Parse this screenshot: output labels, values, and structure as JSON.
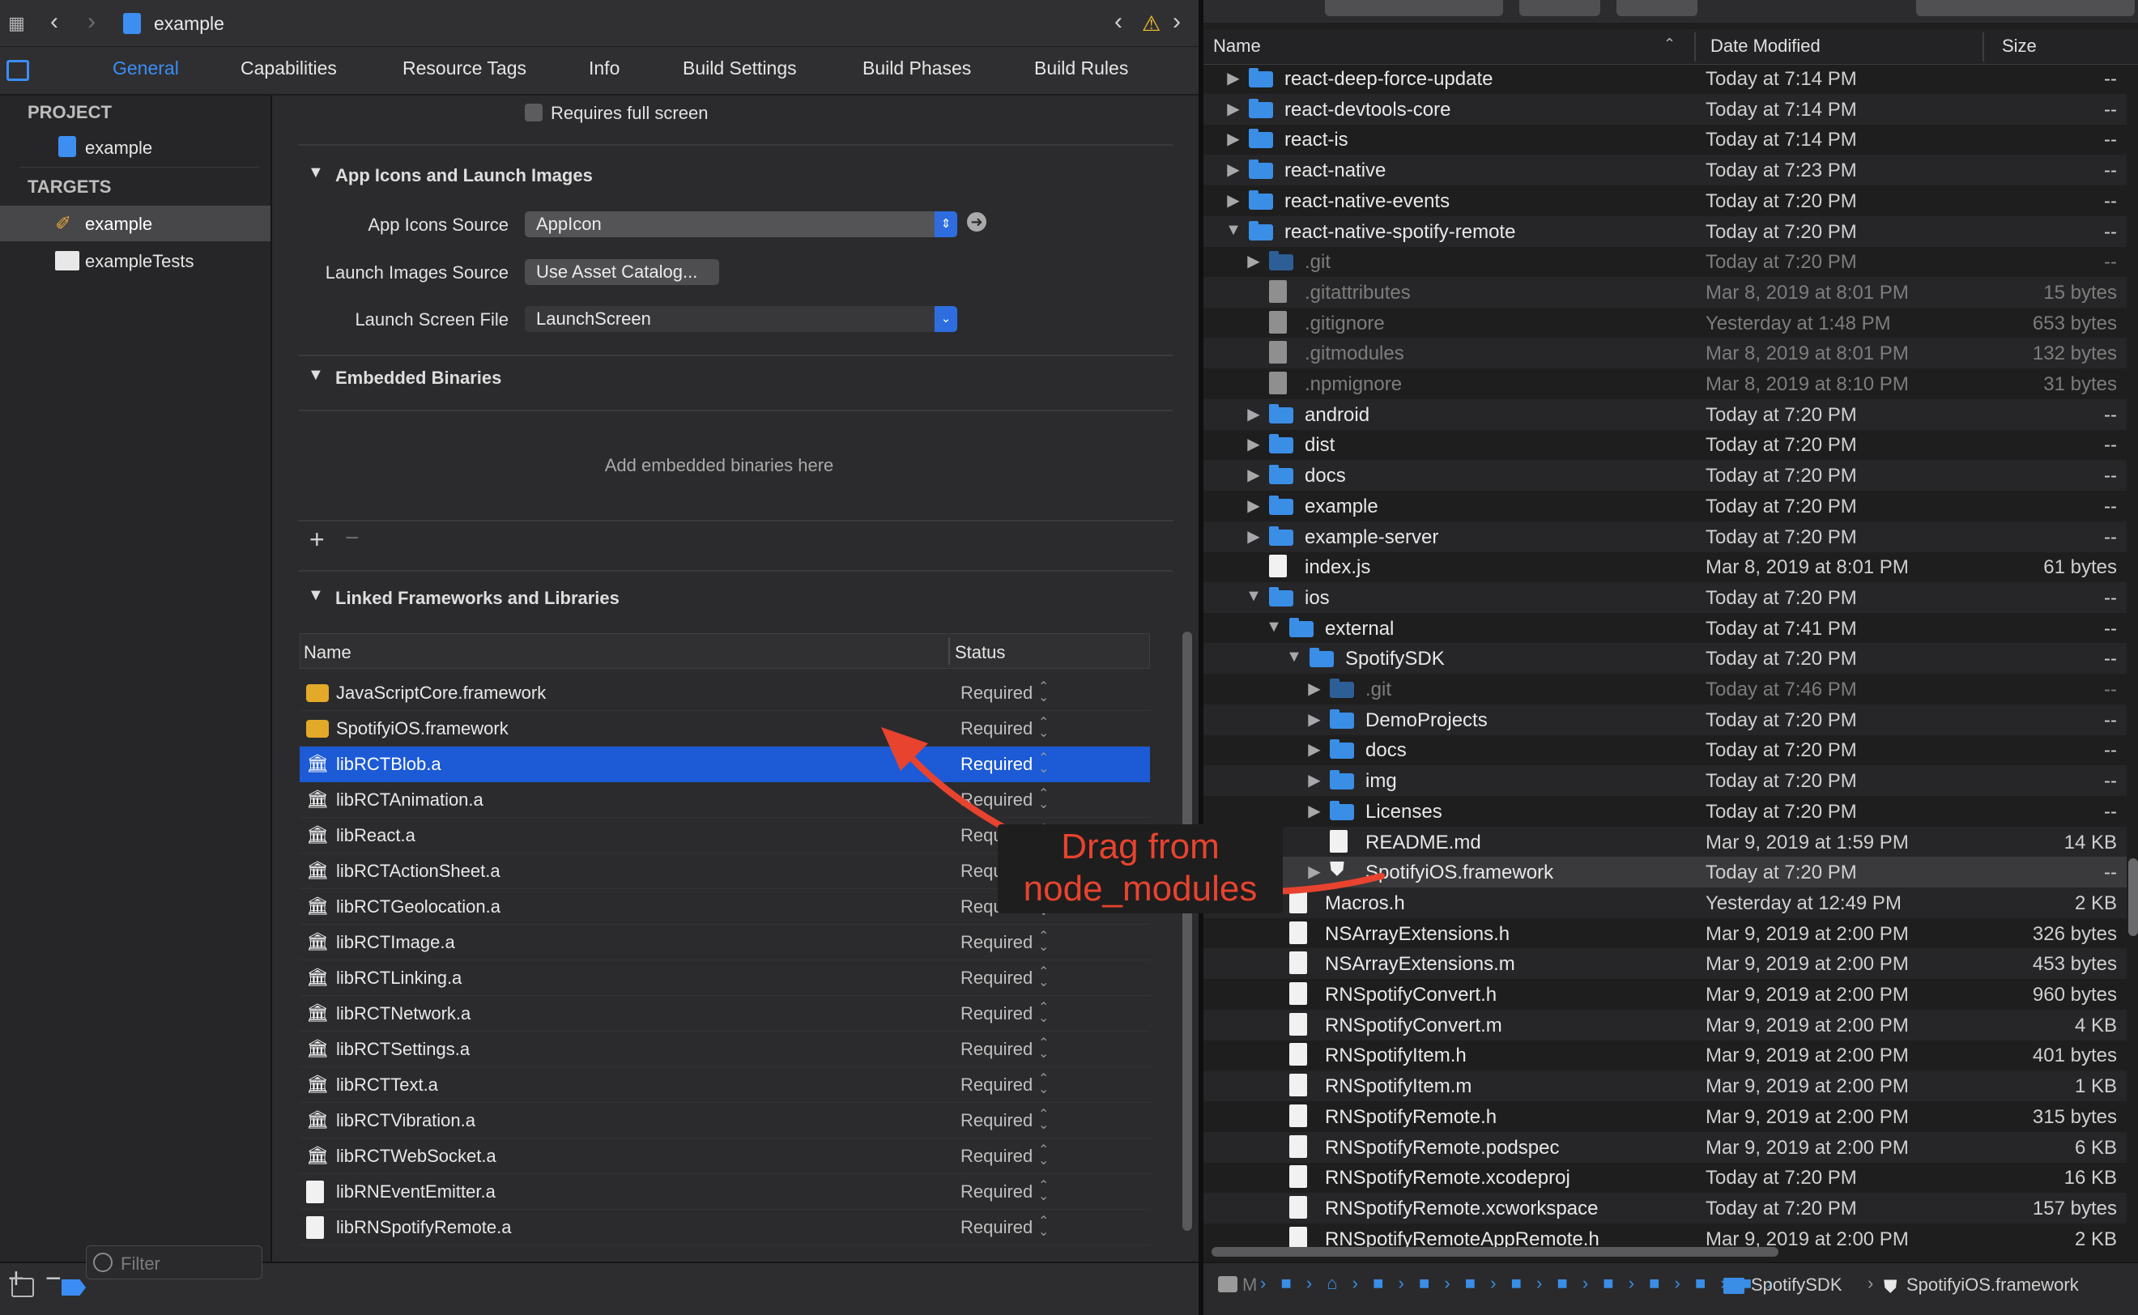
{
  "xcode": {
    "title": "example",
    "tabs": [
      "General",
      "Capabilities",
      "Resource Tags",
      "Info",
      "Build Settings",
      "Build Phases",
      "Build Rules"
    ],
    "sidebar": {
      "project_header": "PROJECT",
      "project_item": "example",
      "targets_header": "TARGETS",
      "targets": [
        "example",
        "exampleTests"
      ],
      "filter_placeholder": "Filter"
    },
    "general": {
      "requires_full_screen": "Requires full screen",
      "app_icons_section": "App Icons and Launch Images",
      "app_icons_source_label": "App Icons Source",
      "app_icons_source_value": "AppIcon",
      "launch_images_source_label": "Launch Images Source",
      "launch_images_button": "Use Asset Catalog...",
      "launch_screen_label": "Launch Screen File",
      "launch_screen_value": "LaunchScreen",
      "embedded_section": "Embedded Binaries",
      "embedded_empty": "Add embedded binaries here",
      "linked_section": "Linked Frameworks and Libraries",
      "col_name": "Name",
      "col_status": "Status",
      "frameworks": [
        {
          "name": "JavaScriptCore.framework",
          "status": "Required",
          "icon": "framework-icon"
        },
        {
          "name": "SpotifyiOS.framework",
          "status": "Required",
          "icon": "framework-icon"
        },
        {
          "name": "libRCTBlob.a",
          "status": "Required",
          "icon": "library-icon"
        },
        {
          "name": "libRCTAnimation.a",
          "status": "Required",
          "icon": "library-icon"
        },
        {
          "name": "libReact.a",
          "status": "Required",
          "icon": "library-icon"
        },
        {
          "name": "libRCTActionSheet.a",
          "status": "Required",
          "icon": "library-icon"
        },
        {
          "name": "libRCTGeolocation.a",
          "status": "Required",
          "icon": "library-icon"
        },
        {
          "name": "libRCTImage.a",
          "status": "Required",
          "icon": "library-icon"
        },
        {
          "name": "libRCTLinking.a",
          "status": "Required",
          "icon": "library-icon"
        },
        {
          "name": "libRCTNetwork.a",
          "status": "Required",
          "icon": "library-icon"
        },
        {
          "name": "libRCTSettings.a",
          "status": "Required",
          "icon": "library-icon"
        },
        {
          "name": "libRCTText.a",
          "status": "Required",
          "icon": "library-icon"
        },
        {
          "name": "libRCTVibration.a",
          "status": "Required",
          "icon": "library-icon"
        },
        {
          "name": "libRCTWebSocket.a",
          "status": "Required",
          "icon": "library-icon"
        },
        {
          "name": "libRNEventEmitter.a",
          "status": "Required",
          "icon": "file-icon"
        },
        {
          "name": "libRNSpotifyRemote.a",
          "status": "Required",
          "icon": "file-icon"
        }
      ],
      "selected_framework": "libRCTBlob.a"
    }
  },
  "annotation": {
    "line1": "Drag from",
    "line2": "node_modules",
    "color": "#e8432f"
  },
  "finder": {
    "col_name": "Name",
    "col_date": "Date Modified",
    "col_size": "Size",
    "rows": [
      {
        "name": "react-deep-force-update",
        "date": "Today at 7:14 PM",
        "size": "--",
        "depth": 0,
        "kind": "folder",
        "disclosure": "closed"
      },
      {
        "name": "react-devtools-core",
        "date": "Today at 7:14 PM",
        "size": "--",
        "depth": 0,
        "kind": "folder",
        "disclosure": "closed"
      },
      {
        "name": "react-is",
        "date": "Today at 7:14 PM",
        "size": "--",
        "depth": 0,
        "kind": "folder",
        "disclosure": "closed"
      },
      {
        "name": "react-native",
        "date": "Today at 7:23 PM",
        "size": "--",
        "depth": 0,
        "kind": "folder",
        "disclosure": "closed"
      },
      {
        "name": "react-native-events",
        "date": "Today at 7:20 PM",
        "size": "--",
        "depth": 0,
        "kind": "folder",
        "disclosure": "closed"
      },
      {
        "name": "react-native-spotify-remote",
        "date": "Today at 7:20 PM",
        "size": "--",
        "depth": 0,
        "kind": "folder",
        "disclosure": "open"
      },
      {
        "name": ".git",
        "date": "Today at 7:20 PM",
        "size": "--",
        "depth": 1,
        "kind": "folder",
        "disclosure": "closed",
        "dim": true
      },
      {
        "name": ".gitattributes",
        "date": "Mar 8, 2019 at 8:01 PM",
        "size": "15 bytes",
        "depth": 1,
        "kind": "doc",
        "dim": true
      },
      {
        "name": ".gitignore",
        "date": "Yesterday at 1:48 PM",
        "size": "653 bytes",
        "depth": 1,
        "kind": "doc",
        "dim": true
      },
      {
        "name": ".gitmodules",
        "date": "Mar 8, 2019 at 8:01 PM",
        "size": "132 bytes",
        "depth": 1,
        "kind": "doc",
        "dim": true
      },
      {
        "name": ".npmignore",
        "date": "Mar 8, 2019 at 8:10 PM",
        "size": "31 bytes",
        "depth": 1,
        "kind": "doc",
        "dim": true
      },
      {
        "name": "android",
        "date": "Today at 7:20 PM",
        "size": "--",
        "depth": 1,
        "kind": "folder",
        "disclosure": "closed"
      },
      {
        "name": "dist",
        "date": "Today at 7:20 PM",
        "size": "--",
        "depth": 1,
        "kind": "folder",
        "disclosure": "closed"
      },
      {
        "name": "docs",
        "date": "Today at 7:20 PM",
        "size": "--",
        "depth": 1,
        "kind": "folder",
        "disclosure": "closed"
      },
      {
        "name": "example",
        "date": "Today at 7:20 PM",
        "size": "--",
        "depth": 1,
        "kind": "folder",
        "disclosure": "closed"
      },
      {
        "name": "example-server",
        "date": "Today at 7:20 PM",
        "size": "--",
        "depth": 1,
        "kind": "folder",
        "disclosure": "closed"
      },
      {
        "name": "index.js",
        "date": "Mar 8, 2019 at 8:01 PM",
        "size": "61 bytes",
        "depth": 1,
        "kind": "doc"
      },
      {
        "name": "ios",
        "date": "Today at 7:20 PM",
        "size": "--",
        "depth": 1,
        "kind": "folder",
        "disclosure": "open"
      },
      {
        "name": "external",
        "date": "Today at 7:41 PM",
        "size": "--",
        "depth": 2,
        "kind": "folder",
        "disclosure": "open"
      },
      {
        "name": "SpotifySDK",
        "date": "Today at 7:20 PM",
        "size": "--",
        "depth": 3,
        "kind": "folder",
        "disclosure": "open"
      },
      {
        "name": ".git",
        "date": "Today at 7:46 PM",
        "size": "--",
        "depth": 4,
        "kind": "folder",
        "disclosure": "closed",
        "dim": true
      },
      {
        "name": "DemoProjects",
        "date": "Today at 7:20 PM",
        "size": "--",
        "depth": 4,
        "kind": "folder",
        "disclosure": "closed"
      },
      {
        "name": "docs",
        "date": "Today at 7:20 PM",
        "size": "--",
        "depth": 4,
        "kind": "folder",
        "disclosure": "closed"
      },
      {
        "name": "img",
        "date": "Today at 7:20 PM",
        "size": "--",
        "depth": 4,
        "kind": "folder",
        "disclosure": "closed"
      },
      {
        "name": "Licenses",
        "date": "Today at 7:20 PM",
        "size": "--",
        "depth": 4,
        "kind": "folder",
        "disclosure": "closed"
      },
      {
        "name": "README.md",
        "date": "Mar 9, 2019 at 1:59 PM",
        "size": "14 KB",
        "depth": 4,
        "kind": "doc"
      },
      {
        "name": "SpotifyiOS.framework",
        "date": "Today at 7:20 PM",
        "size": "--",
        "depth": 4,
        "kind": "shield",
        "disclosure": "closed",
        "highlight": true
      },
      {
        "name": "Macros.h",
        "date": "Yesterday at 12:49 PM",
        "size": "2 KB",
        "depth": 2,
        "kind": "doc"
      },
      {
        "name": "NSArrayExtensions.h",
        "date": "Mar 9, 2019 at 2:00 PM",
        "size": "326 bytes",
        "depth": 2,
        "kind": "doc"
      },
      {
        "name": "NSArrayExtensions.m",
        "date": "Mar 9, 2019 at 2:00 PM",
        "size": "453 bytes",
        "depth": 2,
        "kind": "doc"
      },
      {
        "name": "RNSpotifyConvert.h",
        "date": "Mar 9, 2019 at 2:00 PM",
        "size": "960 bytes",
        "depth": 2,
        "kind": "doc"
      },
      {
        "name": "RNSpotifyConvert.m",
        "date": "Mar 9, 2019 at 2:00 PM",
        "size": "4 KB",
        "depth": 2,
        "kind": "doc"
      },
      {
        "name": "RNSpotifyItem.h",
        "date": "Mar 9, 2019 at 2:00 PM",
        "size": "401 bytes",
        "depth": 2,
        "kind": "doc"
      },
      {
        "name": "RNSpotifyItem.m",
        "date": "Mar 9, 2019 at 2:00 PM",
        "size": "1 KB",
        "depth": 2,
        "kind": "doc"
      },
      {
        "name": "RNSpotifyRemote.h",
        "date": "Mar 9, 2019 at 2:00 PM",
        "size": "315 bytes",
        "depth": 2,
        "kind": "doc"
      },
      {
        "name": "RNSpotifyRemote.podspec",
        "date": "Mar 9, 2019 at 2:00 PM",
        "size": "6 KB",
        "depth": 2,
        "kind": "doc"
      },
      {
        "name": "RNSpotifyRemote.xcodeproj",
        "date": "Today at 7:20 PM",
        "size": "16 KB",
        "depth": 2,
        "kind": "doc"
      },
      {
        "name": "RNSpotifyRemote.xcworkspace",
        "date": "Today at 7:20 PM",
        "size": "157 bytes",
        "depth": 2,
        "kind": "doc"
      },
      {
        "name": "RNSpotifyRemoteAppRemote.h",
        "date": "Mar 9, 2019 at 2:00 PM",
        "size": "2 KB",
        "depth": 2,
        "kind": "doc"
      }
    ],
    "path_bar": {
      "first": "M",
      "second_last": "SpotifySDK",
      "last": "SpotifyiOS.framework"
    }
  }
}
